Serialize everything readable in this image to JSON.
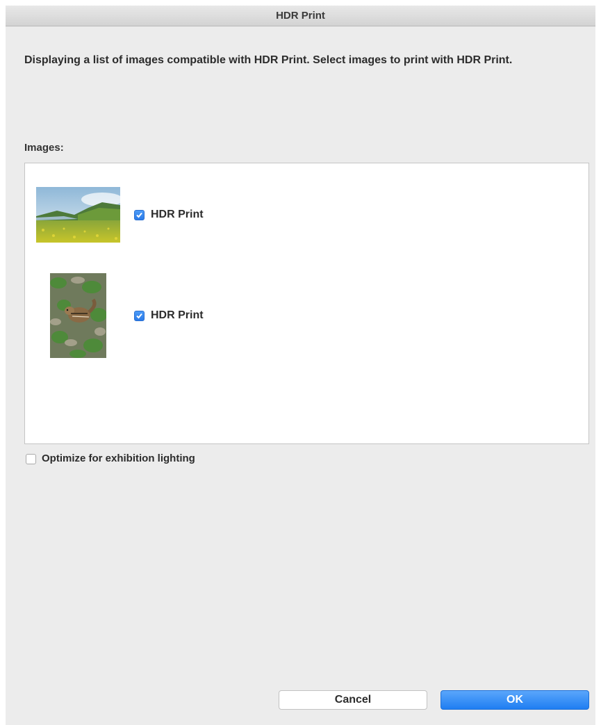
{
  "dialog": {
    "title": "HDR Print",
    "description": "Displaying a list of images compatible with HDR Print. Select images to print with HDR Print.",
    "images_label": "Images:",
    "images": [
      {
        "subject": "landscape-meadow",
        "checkbox_label": "HDR Print",
        "checked": true
      },
      {
        "subject": "chipmunk",
        "checkbox_label": "HDR Print",
        "checked": true
      }
    ],
    "optimize_label": "Optimize for exhibition lighting",
    "optimize_checked": false,
    "cancel_label": "Cancel",
    "ok_label": "OK"
  },
  "colors": {
    "accent": "#2a7ae8",
    "dialog_bg": "#ececec"
  }
}
